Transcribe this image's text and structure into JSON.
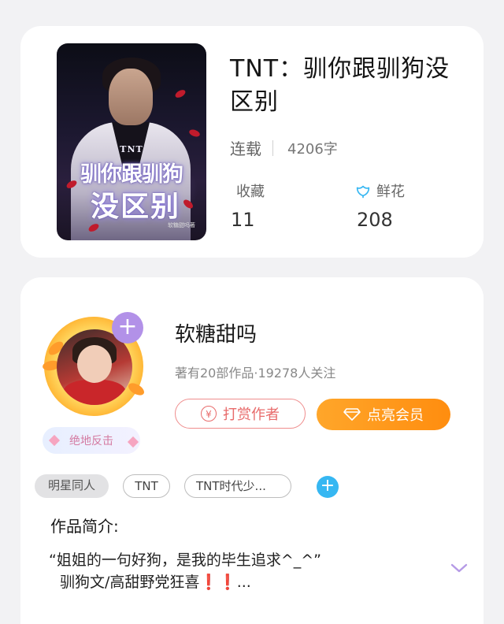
{
  "book": {
    "cover_text": {
      "small": "TNT",
      "line1": "驯你跟驯狗",
      "line2": "没区别",
      "author": "软糖甜吗著"
    },
    "title": "TNT：驯你跟驯狗没区别",
    "status": "连载",
    "word_count": "4206字",
    "favorites_label": "收藏",
    "favorites_value": "11",
    "flowers_label": "鲜花",
    "flowers_value": "208"
  },
  "author": {
    "name": "软糖甜吗",
    "stats": "著有20部作品·19278人关注",
    "badge": "绝地反击",
    "tip_button": "打赏作者",
    "vip_button": "点亮会员",
    "follow_icon": "plus-icon"
  },
  "tags": [
    "明星同人",
    "TNT",
    "TNT时代少..."
  ],
  "intro": {
    "heading": "作品简介:",
    "line1": "“姐姐的一句好狗，是我的毕生追求^_^”",
    "line2": "驯狗文/高甜野党狂喜❗❗..."
  },
  "colors": {
    "accent_orange": "#ff9a1f",
    "tip_red": "#e86b6b",
    "tag_blue": "#36b7f2",
    "purple_badge": "#b291e8"
  },
  "icons": [
    "flower-icon",
    "yen-icon",
    "diamond-icon",
    "plus-icon",
    "chevron-down-icon"
  ]
}
